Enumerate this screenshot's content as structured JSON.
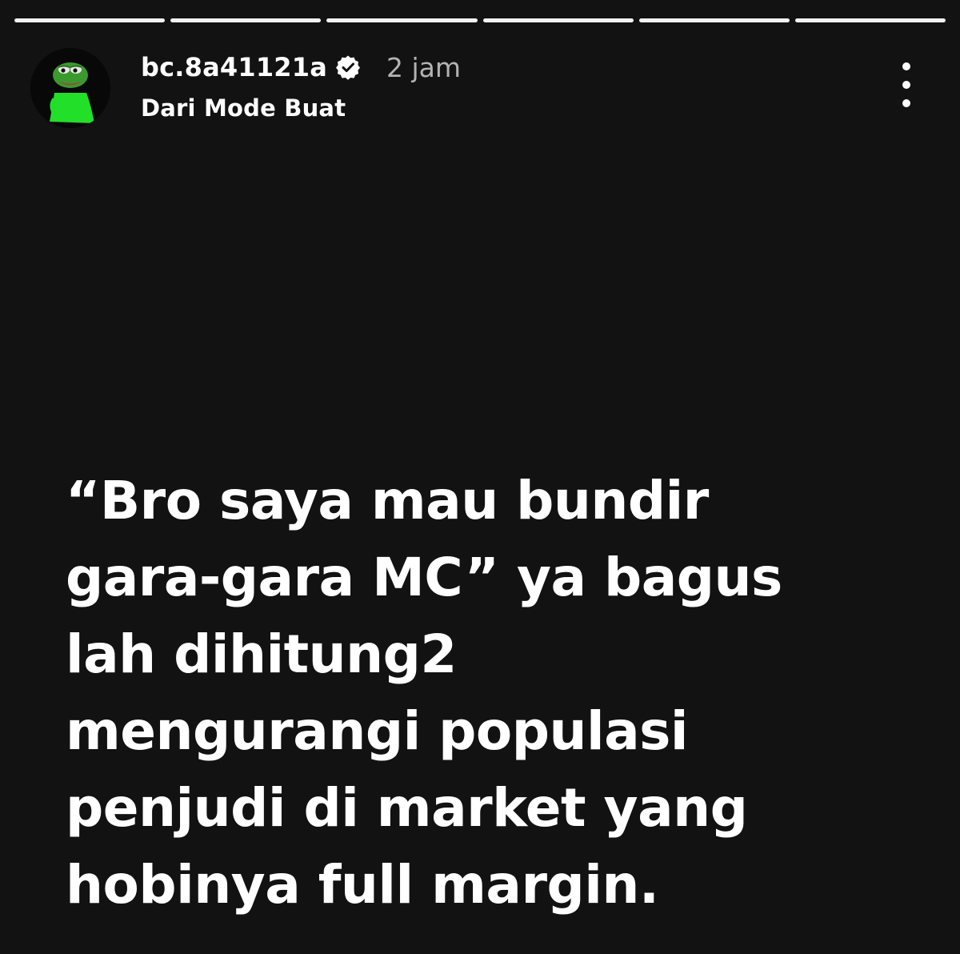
{
  "progress": {
    "segment_count": 6,
    "segment_color": "#f2f2f2"
  },
  "header": {
    "username": "bc.8a41121a",
    "verified": true,
    "time": "2 jam",
    "subtitle": "Dari Mode Buat",
    "avatar_icon": "pepe-frog-avatar-icon",
    "menu_icon": "more-vertical-icon"
  },
  "story": {
    "background": "#121212",
    "lines": [
      "“Bro saya mau bundir",
      "gara-gara MC” ya bagus",
      "lah dihitung2",
      "mengurangi populasi",
      "penjudi di market yang",
      "hobinya full margin."
    ]
  }
}
